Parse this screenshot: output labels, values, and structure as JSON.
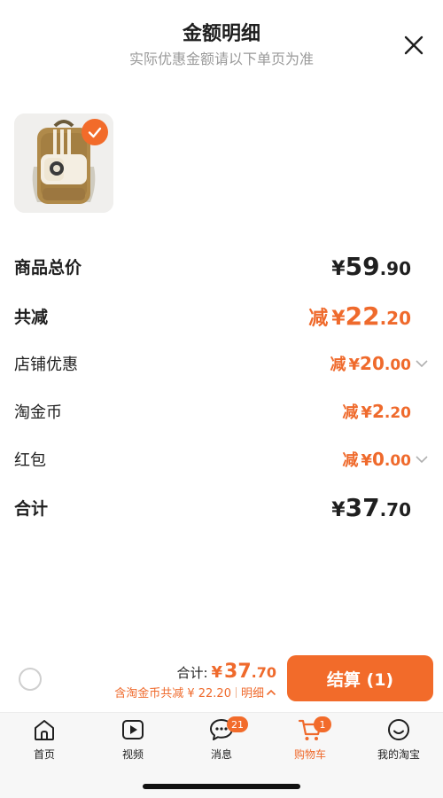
{
  "header": {
    "title": "金额明细",
    "subtitle": "实际优惠金额请以下单页为准"
  },
  "product": {
    "image": "backpack-image",
    "selected": true
  },
  "breakdown": {
    "subtotal": {
      "label": "商品总价",
      "currency": "¥",
      "int": "59",
      "dec": ".90"
    },
    "total_discount": {
      "label": "共减",
      "minus": "减",
      "currency": "¥",
      "int": "22",
      "dec": ".20"
    },
    "store_discount": {
      "label": "店铺优惠",
      "minus": "减",
      "currency": "¥",
      "int": "20",
      "dec": ".00"
    },
    "taojinbi": {
      "label": "淘金币",
      "minus": "减",
      "currency": "¥",
      "int": "2",
      "dec": ".20"
    },
    "red_packet": {
      "label": "红包",
      "minus": "减",
      "currency": "¥",
      "int": "0",
      "dec": ".00"
    },
    "total": {
      "label": "合计",
      "currency": "¥",
      "int": "37",
      "dec": ".70"
    }
  },
  "checkout": {
    "total_label": "合计:",
    "currency": "¥",
    "total_int": "37",
    "total_dec": ".70",
    "savings_text": "含淘金币共减 ¥ 22.20",
    "details_label": "明细",
    "button_label": "结算 (1)"
  },
  "tabbar": {
    "tabs": [
      {
        "label": "首页",
        "icon": "home-icon"
      },
      {
        "label": "视频",
        "icon": "video-icon"
      },
      {
        "label": "消息",
        "icon": "message-icon",
        "badge": "21"
      },
      {
        "label": "购物车",
        "icon": "cart-icon",
        "badge": "1",
        "active": true
      },
      {
        "label": "我的淘宝",
        "icon": "profile-icon"
      }
    ]
  },
  "colors": {
    "accent": "#f26b2a",
    "text": "#1f1f1f",
    "muted": "#9a9a9a"
  }
}
